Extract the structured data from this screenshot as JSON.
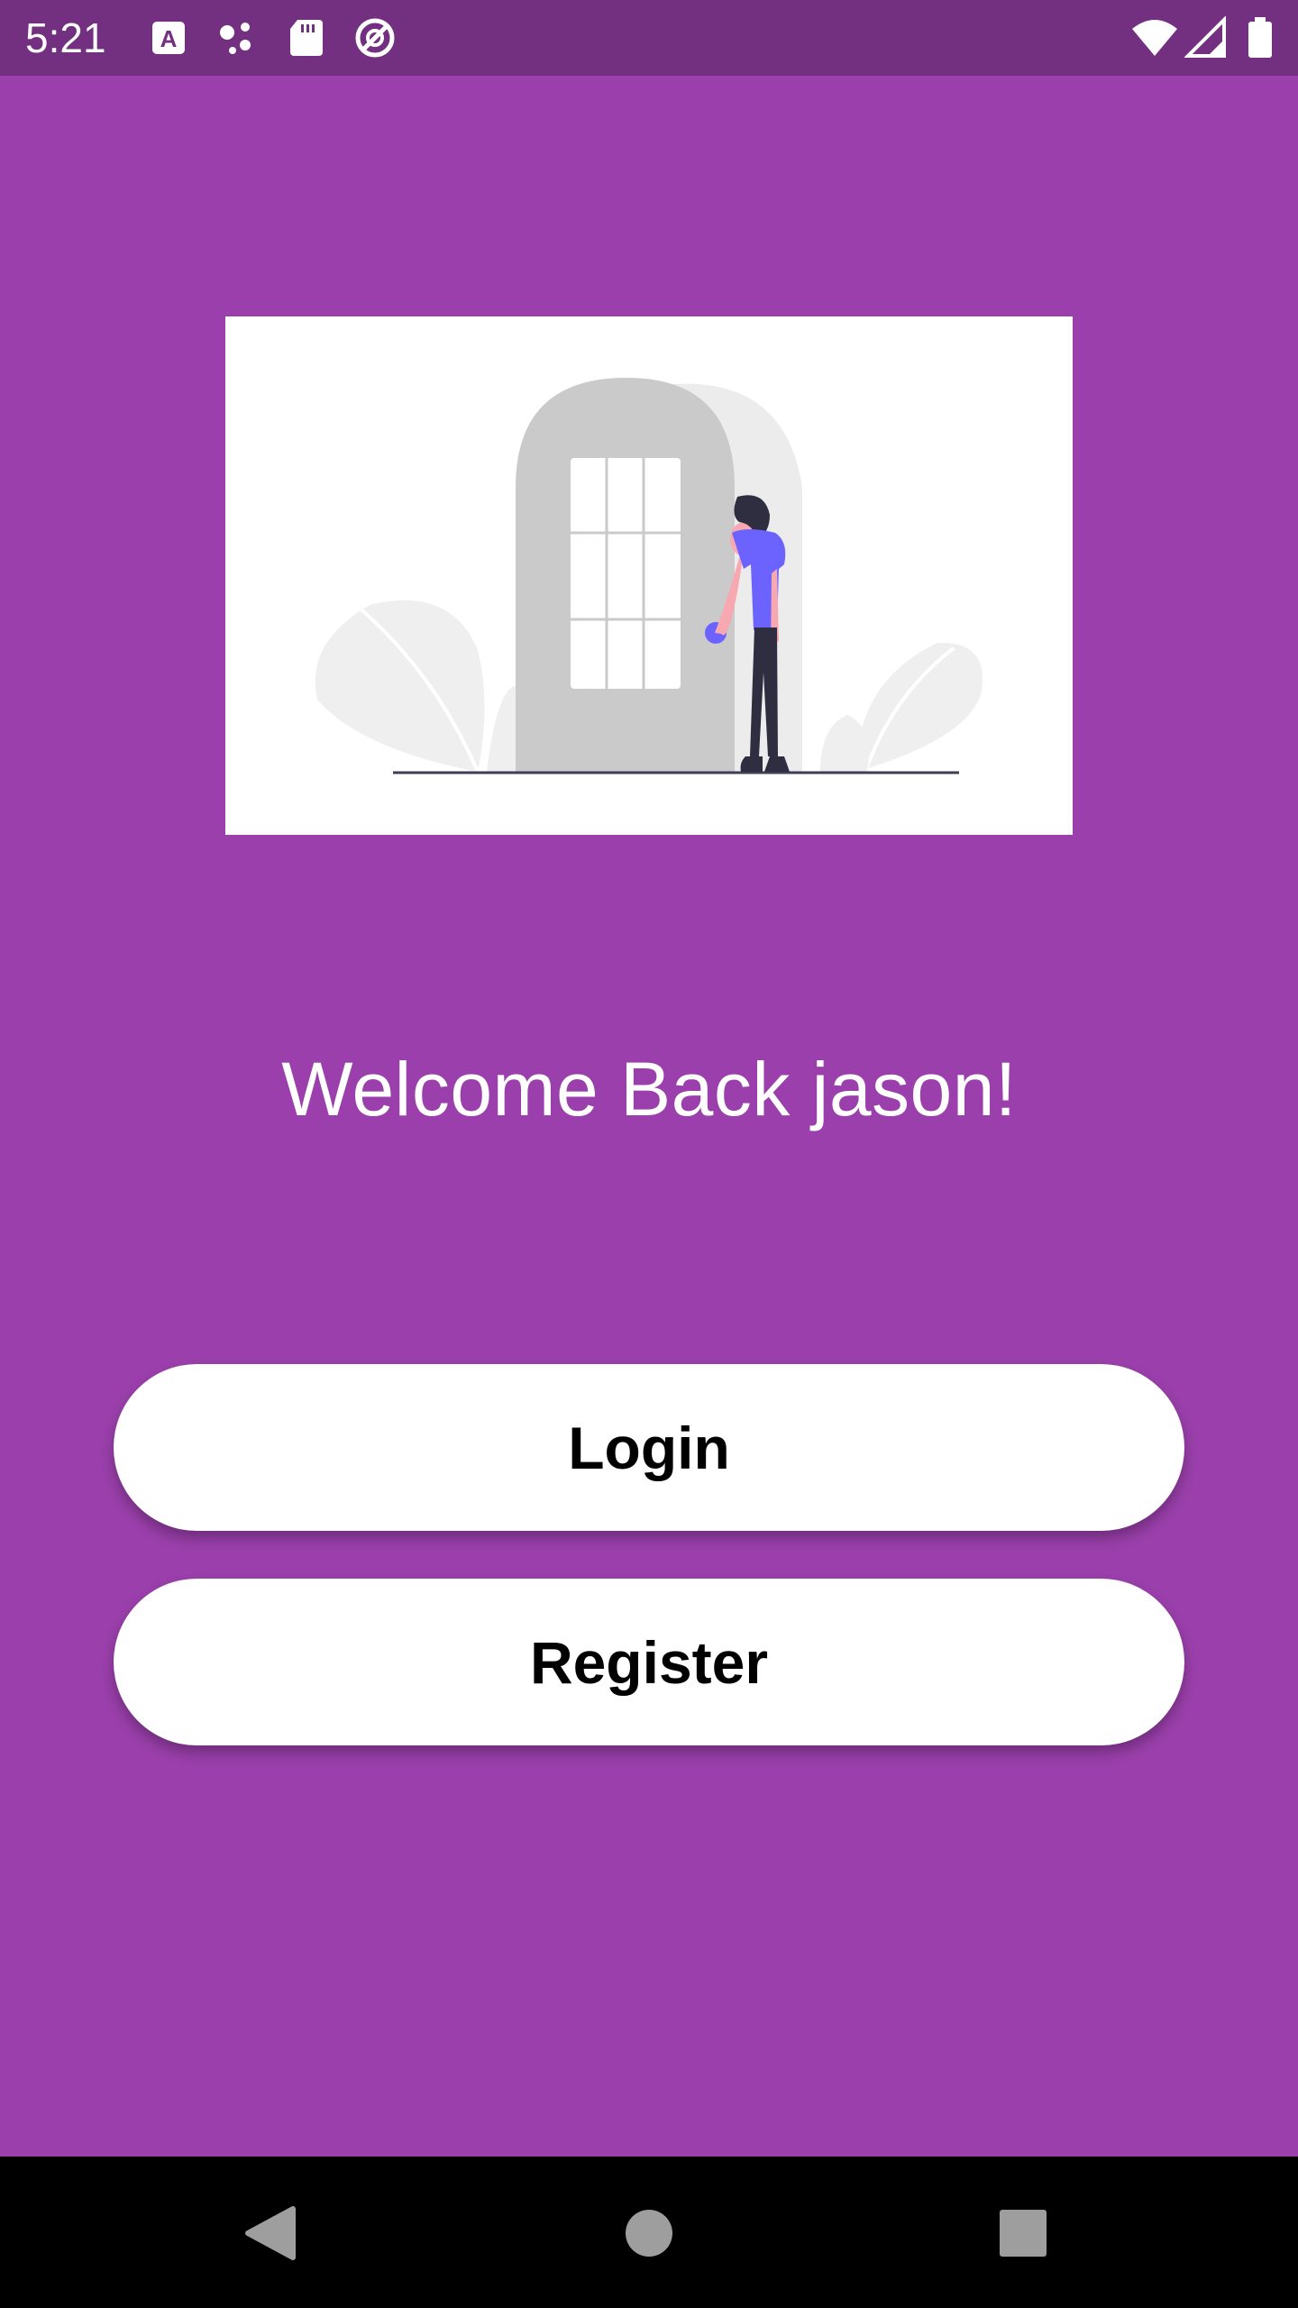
{
  "status_bar": {
    "time": "5:21",
    "left_icons": [
      "font-app-icon",
      "notification-dots-icon",
      "sd-card-icon",
      "data-saver-icon"
    ],
    "right_icons": [
      "wifi-icon",
      "cellular-signal-icon",
      "battery-icon"
    ]
  },
  "hero": {
    "illustration": "person-opening-door-illustration"
  },
  "welcome_text": "Welcome Back jason!",
  "buttons": {
    "login": "Login",
    "register": "Register"
  },
  "navigation_bar": {
    "icons": [
      "back-icon",
      "home-icon",
      "recents-icon"
    ]
  },
  "colors": {
    "background": "#9a3fab",
    "status_bar": "#732f80",
    "button": "#ffffff",
    "illustration_accent": "#6c63ff"
  }
}
